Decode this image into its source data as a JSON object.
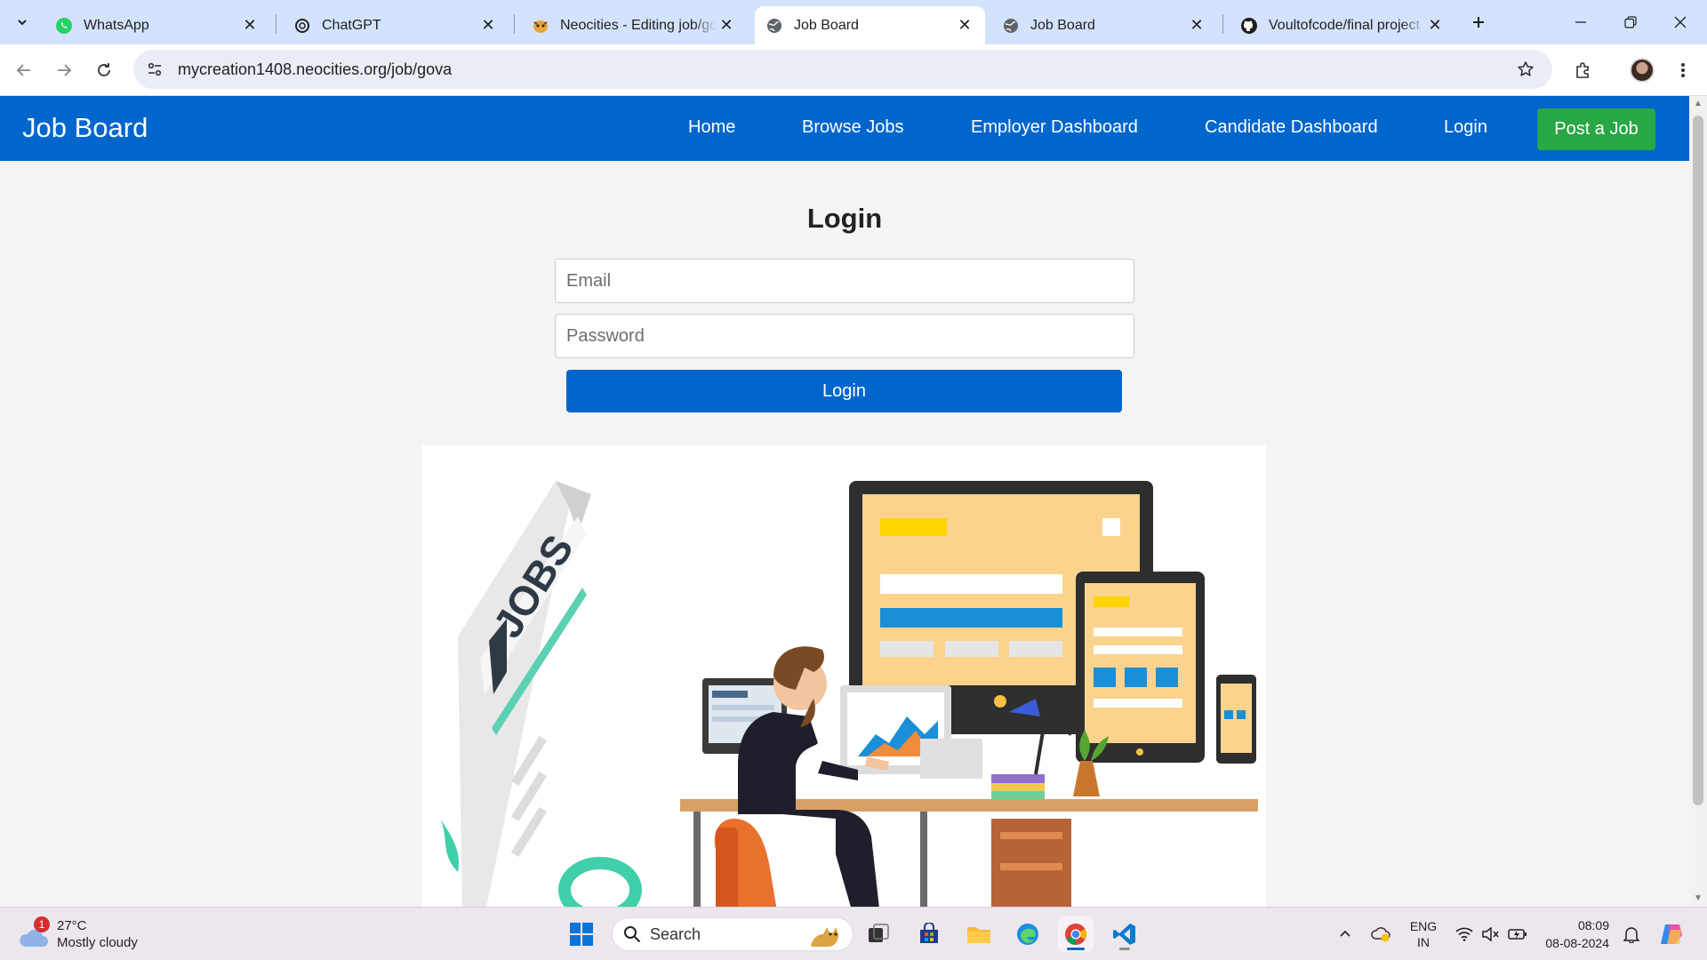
{
  "browser": {
    "tabs": [
      {
        "title": "WhatsApp",
        "icon": "whatsapp-icon",
        "active": false
      },
      {
        "title": "ChatGPT",
        "icon": "chatgpt-icon",
        "active": false
      },
      {
        "title": "Neocities - Editing job/gova",
        "icon": "neocities-icon",
        "active": false
      },
      {
        "title": "Job Board",
        "icon": "globe-icon",
        "active": true
      },
      {
        "title": "Job Board",
        "icon": "globe-icon",
        "active": false
      },
      {
        "title": "Voultofcode/final project a",
        "icon": "github-icon",
        "active": false
      }
    ],
    "url": "mycreation1408.neocities.org/job/gova"
  },
  "site": {
    "brand": "Job Board",
    "nav": {
      "home": "Home",
      "browse_jobs": "Browse Jobs",
      "employer_dashboard": "Employer Dashboard",
      "candidate_dashboard": "Candidate Dashboard",
      "login": "Login",
      "post_job": "Post a Job"
    },
    "colors": {
      "nav_bg": "#0066cc",
      "post_job_bg": "#28a745",
      "button_bg": "#0066cc"
    }
  },
  "login_form": {
    "title": "Login",
    "email_placeholder": "Email",
    "password_placeholder": "Password",
    "submit_label": "Login"
  },
  "hero_image": {
    "sign_text": "JOBS"
  },
  "taskbar": {
    "weather": {
      "temp": "27°C",
      "condition": "Mostly cloudy",
      "badge": "1"
    },
    "search_label": "Search",
    "language": {
      "line1": "ENG",
      "line2": "IN"
    },
    "time": "08:09",
    "date": "08-08-2024"
  }
}
